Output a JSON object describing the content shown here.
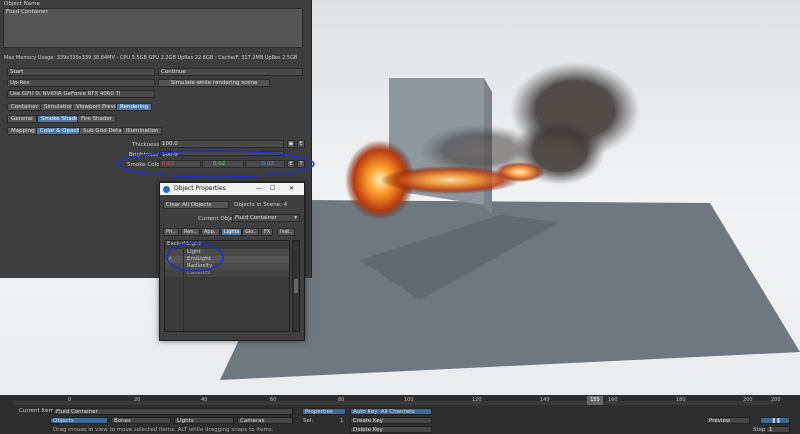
{
  "panel": {
    "object_name_label": "Object Name",
    "object_name_value": "Fluid Container",
    "memory_usage": "Max Memory Usage: 339x339x339 38.84MV - CPU 3.5GB GPU 2.2GB UpRes 22.6GB - Cache/F: 317.2MB UpRes 2.5GB",
    "start": "Start",
    "continue": "Continue",
    "upres": "Up-Res",
    "simulate": "Simulate while rendering scene",
    "gpu": "Use GPU 0: NVIDIA GeForce RTX 4060 Ti",
    "tabs1": [
      "Container",
      "Simulation",
      "Viewport Preview",
      "Rendering"
    ],
    "tabs2": [
      "General",
      "Smoke Shader",
      "Fire Shader"
    ],
    "tabs3": [
      "Mapping",
      "Color & Opacity",
      "Sub Grid Detail",
      "Illumination"
    ],
    "thickness_label": "Thickness",
    "thickness_value": "100.0",
    "brightness_label": "Brightness",
    "brightness_value": "100.0",
    "smoke_color_label": "Smoke Color",
    "smoke_r": "0.02",
    "smoke_g": "0.02",
    "smoke_b": "0.02",
    "e_label": "E",
    "t_label": "T"
  },
  "dialog": {
    "title": "Object Properties",
    "clear_all": "Clear All Objects",
    "objects_in_scene": "Objects in Scene: 4",
    "current_object_label": "Current Object",
    "current_object_value": "Fluid Container",
    "tabs": [
      "Pri..",
      "Ren..",
      "App..",
      "Lights",
      "Glo..",
      "FX",
      "Inst.."
    ],
    "exclude_label": "Exclude",
    "exclude_col": "Light",
    "lights": [
      {
        "name": "Light",
        "checked": ""
      },
      {
        "name": "EnvLight",
        "checked": "✓"
      },
      {
        "name": "Radiosity",
        "checked": ""
      },
      {
        "name": "Caustics",
        "checked": ""
      }
    ]
  },
  "timeline": {
    "ticks": [
      "0",
      "20",
      "40",
      "60",
      "80",
      "100",
      "120",
      "140",
      "160",
      "180",
      "200",
      "200"
    ],
    "current_frame": "155",
    "current_item_label": "Current Item",
    "current_item_value": "Fluid Container",
    "objects": "Objects",
    "bones": "Bones",
    "lights": "Lights",
    "cameras": "Cameras",
    "properties": "Properties",
    "sel_label": "Sel:",
    "sel_value": "1",
    "auto_key": "Auto Key: All Channels",
    "create_key": "Create Key",
    "delete_key": "Delete Key",
    "preview": "Preview",
    "step_label": "Step",
    "step_value": "1",
    "hint": "Drag mouse in view to move selected items. ALT while dragging snaps to items."
  },
  "colors": {
    "accent": "#4a78a8",
    "annotation": "#1f2fd0",
    "smoke_r": "#e05050",
    "smoke_g": "#6fd06f",
    "smoke_b": "#6f7fe0"
  }
}
